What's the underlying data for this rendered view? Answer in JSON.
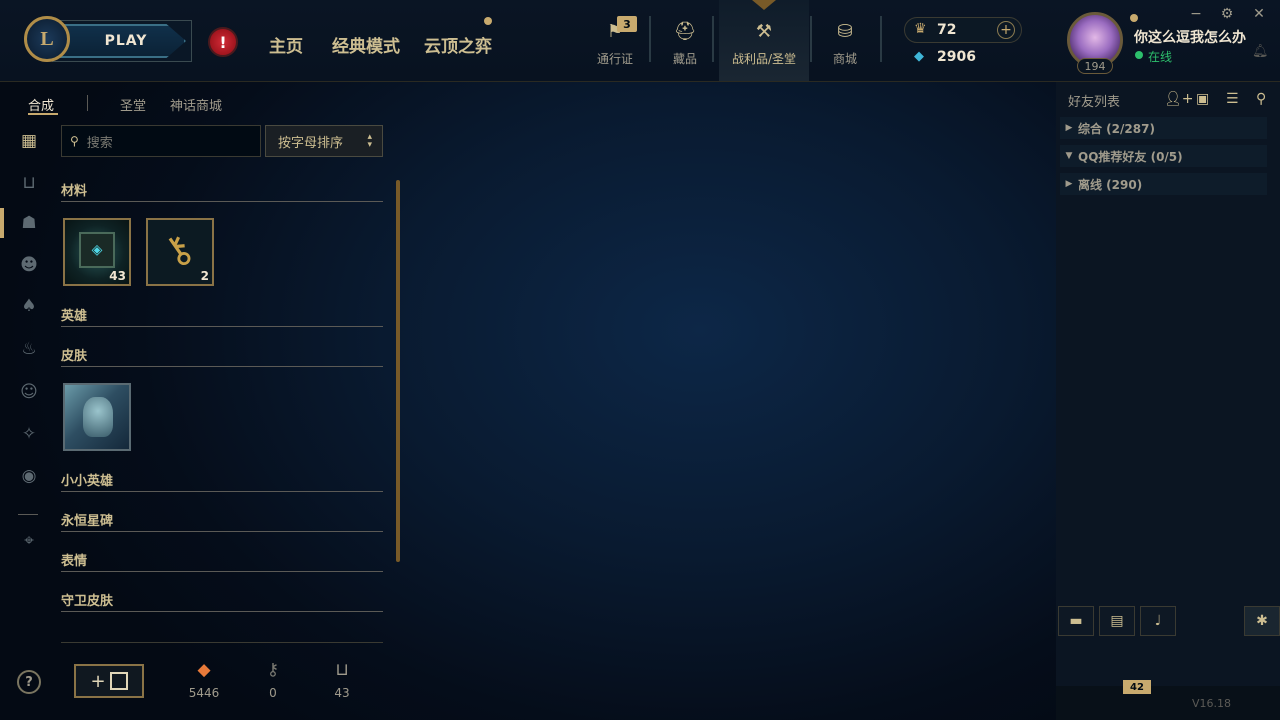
{
  "topbar": {
    "logo_text": "L",
    "play_label": "PLAY",
    "alert_symbol": "!",
    "nav": [
      "主页",
      "经典模式",
      "云顶之弈"
    ],
    "icons_nav": [
      {
        "label": "通行证",
        "icon": "pass-icon"
      },
      {
        "label": "藏品",
        "icon": "collection-icon"
      },
      {
        "label": "战利品/圣堂",
        "icon": "loot-icon"
      },
      {
        "label": "商城",
        "icon": "store-icon"
      }
    ],
    "pass_badge": "3",
    "currency": {
      "rp": "72",
      "be": "2906",
      "plus": "+"
    },
    "profile": {
      "name": "你这么逗我怎么办",
      "status": "在线",
      "level": "194"
    },
    "window": [
      "−",
      "⚙",
      "✕"
    ]
  },
  "loot": {
    "subtabs": [
      "合成",
      "圣堂",
      "神话商城"
    ],
    "search_placeholder": "搜索",
    "sort_label": "按字母排序",
    "sections": [
      "材料",
      "英雄",
      "皮肤",
      "小小英雄",
      "永恒星碑",
      "表情",
      "守卫皮肤"
    ],
    "materials": [
      {
        "count": "43",
        "icon": "chest-icon"
      },
      {
        "count": "2",
        "icon": "key-icon"
      }
    ],
    "skins": [
      {
        "icon": "skin-shard-icon"
      }
    ],
    "craft_label": "+",
    "resources": [
      {
        "value": "5446",
        "icon": "essence-icon"
      },
      {
        "value": "0",
        "icon": "key-fragment-icon"
      },
      {
        "value": "43",
        "icon": "chest-small-icon"
      }
    ],
    "help": "?"
  },
  "friends": {
    "title": "好友列表",
    "groups": [
      {
        "label": "综合 (2/287)",
        "open": false
      },
      {
        "label": "QQ推荐好友 (0/5)",
        "open": true
      },
      {
        "label": "离线 (290)",
        "open": false
      }
    ],
    "chat_badge": "42",
    "version": "V16.18"
  },
  "colors": {
    "gold": "#c8aa6e",
    "text": "#cdbe91",
    "online": "#2dbf6c",
    "be": "#3fb6d8",
    "alert": "#d22a36"
  }
}
